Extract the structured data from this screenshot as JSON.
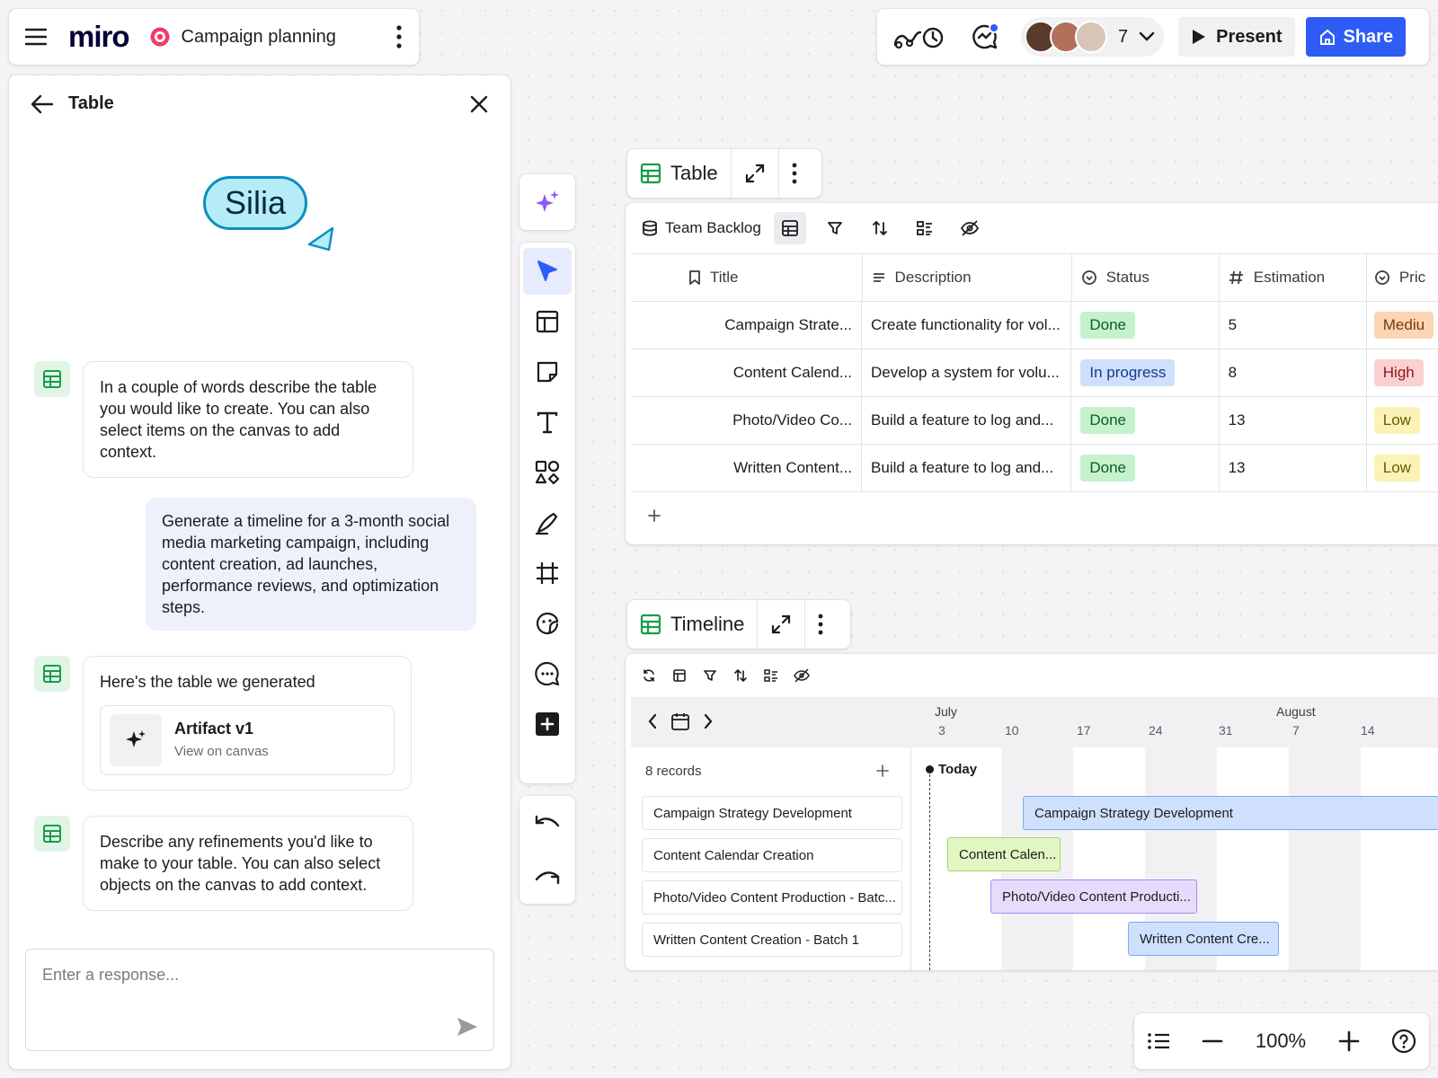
{
  "board": {
    "logo": "miro",
    "name": "Campaign planning"
  },
  "collab": {
    "user_count": "7",
    "present_label": "Present",
    "share_label": "Share"
  },
  "assistant": {
    "title": "Table",
    "cursor_label": "Silia",
    "messages": [
      {
        "role": "assistant",
        "text": "In a couple of words describe the table you would like to create. You can also select items on the canvas to add context."
      },
      {
        "role": "user",
        "text": "Generate a timeline for a 3-month social media marketing campaign, including content creation, ad launches, performance reviews, and optimization steps."
      },
      {
        "role": "assistant",
        "text": "Here's the table we generated",
        "artifact": {
          "title": "Artifact v1",
          "subtitle": "View on canvas"
        }
      },
      {
        "role": "assistant",
        "text": "Describe any refinements you'd like to make to your table. You can also select objects on the canvas to add context."
      }
    ],
    "input_placeholder": "Enter a response..."
  },
  "table_widget": {
    "label": "Table",
    "source": "Team Backlog",
    "columns": [
      "Title",
      "Description",
      "Status",
      "Estimation",
      "Pric"
    ],
    "rows": [
      {
        "title": "Campaign Strate...",
        "description": "Create functionality for vol...",
        "status": "Done",
        "estimation": "5",
        "priority": "Mediu"
      },
      {
        "title": "Content Calend...",
        "description": "Develop a system for volu...",
        "status": "In progress",
        "estimation": "8",
        "priority": "High"
      },
      {
        "title": "Photo/Video Co...",
        "description": "Build a feature to log and...",
        "status": "Done",
        "estimation": "13",
        "priority": "Low"
      },
      {
        "title": "Written Content...",
        "description": "Build a feature to log and...",
        "status": "Done",
        "estimation": "13",
        "priority": "Low"
      }
    ],
    "status_colors": {
      "Done": "#c6f1cd",
      "In progress": "#cfe0fd"
    },
    "priority_colors": {
      "Mediu": "#fbd5b4",
      "High": "#fbd0d0",
      "Low": "#fbf2b6"
    }
  },
  "timeline_widget": {
    "label": "Timeline",
    "records_label": "8 records",
    "today_label": "Today",
    "months": [
      "July",
      "August"
    ],
    "days": [
      "3",
      "10",
      "17",
      "24",
      "31",
      "7",
      "14"
    ],
    "records": [
      "Campaign Strategy Development",
      "Content Calendar Creation",
      "Photo/Video Content Production - Batc...",
      "Written Content Creation - Batch 1"
    ],
    "bars": [
      {
        "label": "Campaign Strategy Development",
        "color": "#cfe0fd",
        "border": "#7fa7f0"
      },
      {
        "label": "Content Calen...",
        "color": "#e2f7c4",
        "border": "#a6d86a"
      },
      {
        "label": "Photo/Video Content Producti...",
        "color": "#e5dcfb",
        "border": "#a78bf0"
      },
      {
        "label": "Written Content Cre...",
        "color": "#cfe0fd",
        "border": "#7fa7f0"
      }
    ]
  },
  "zoom": {
    "level": "100%"
  },
  "colors": {
    "accent": "#2f5cf7",
    "ai_purple": "#8b5cf6",
    "table_green": "#1a9b4a",
    "silia_fill": "#b6ebf8",
    "silia_border": "#0c8fc0"
  }
}
